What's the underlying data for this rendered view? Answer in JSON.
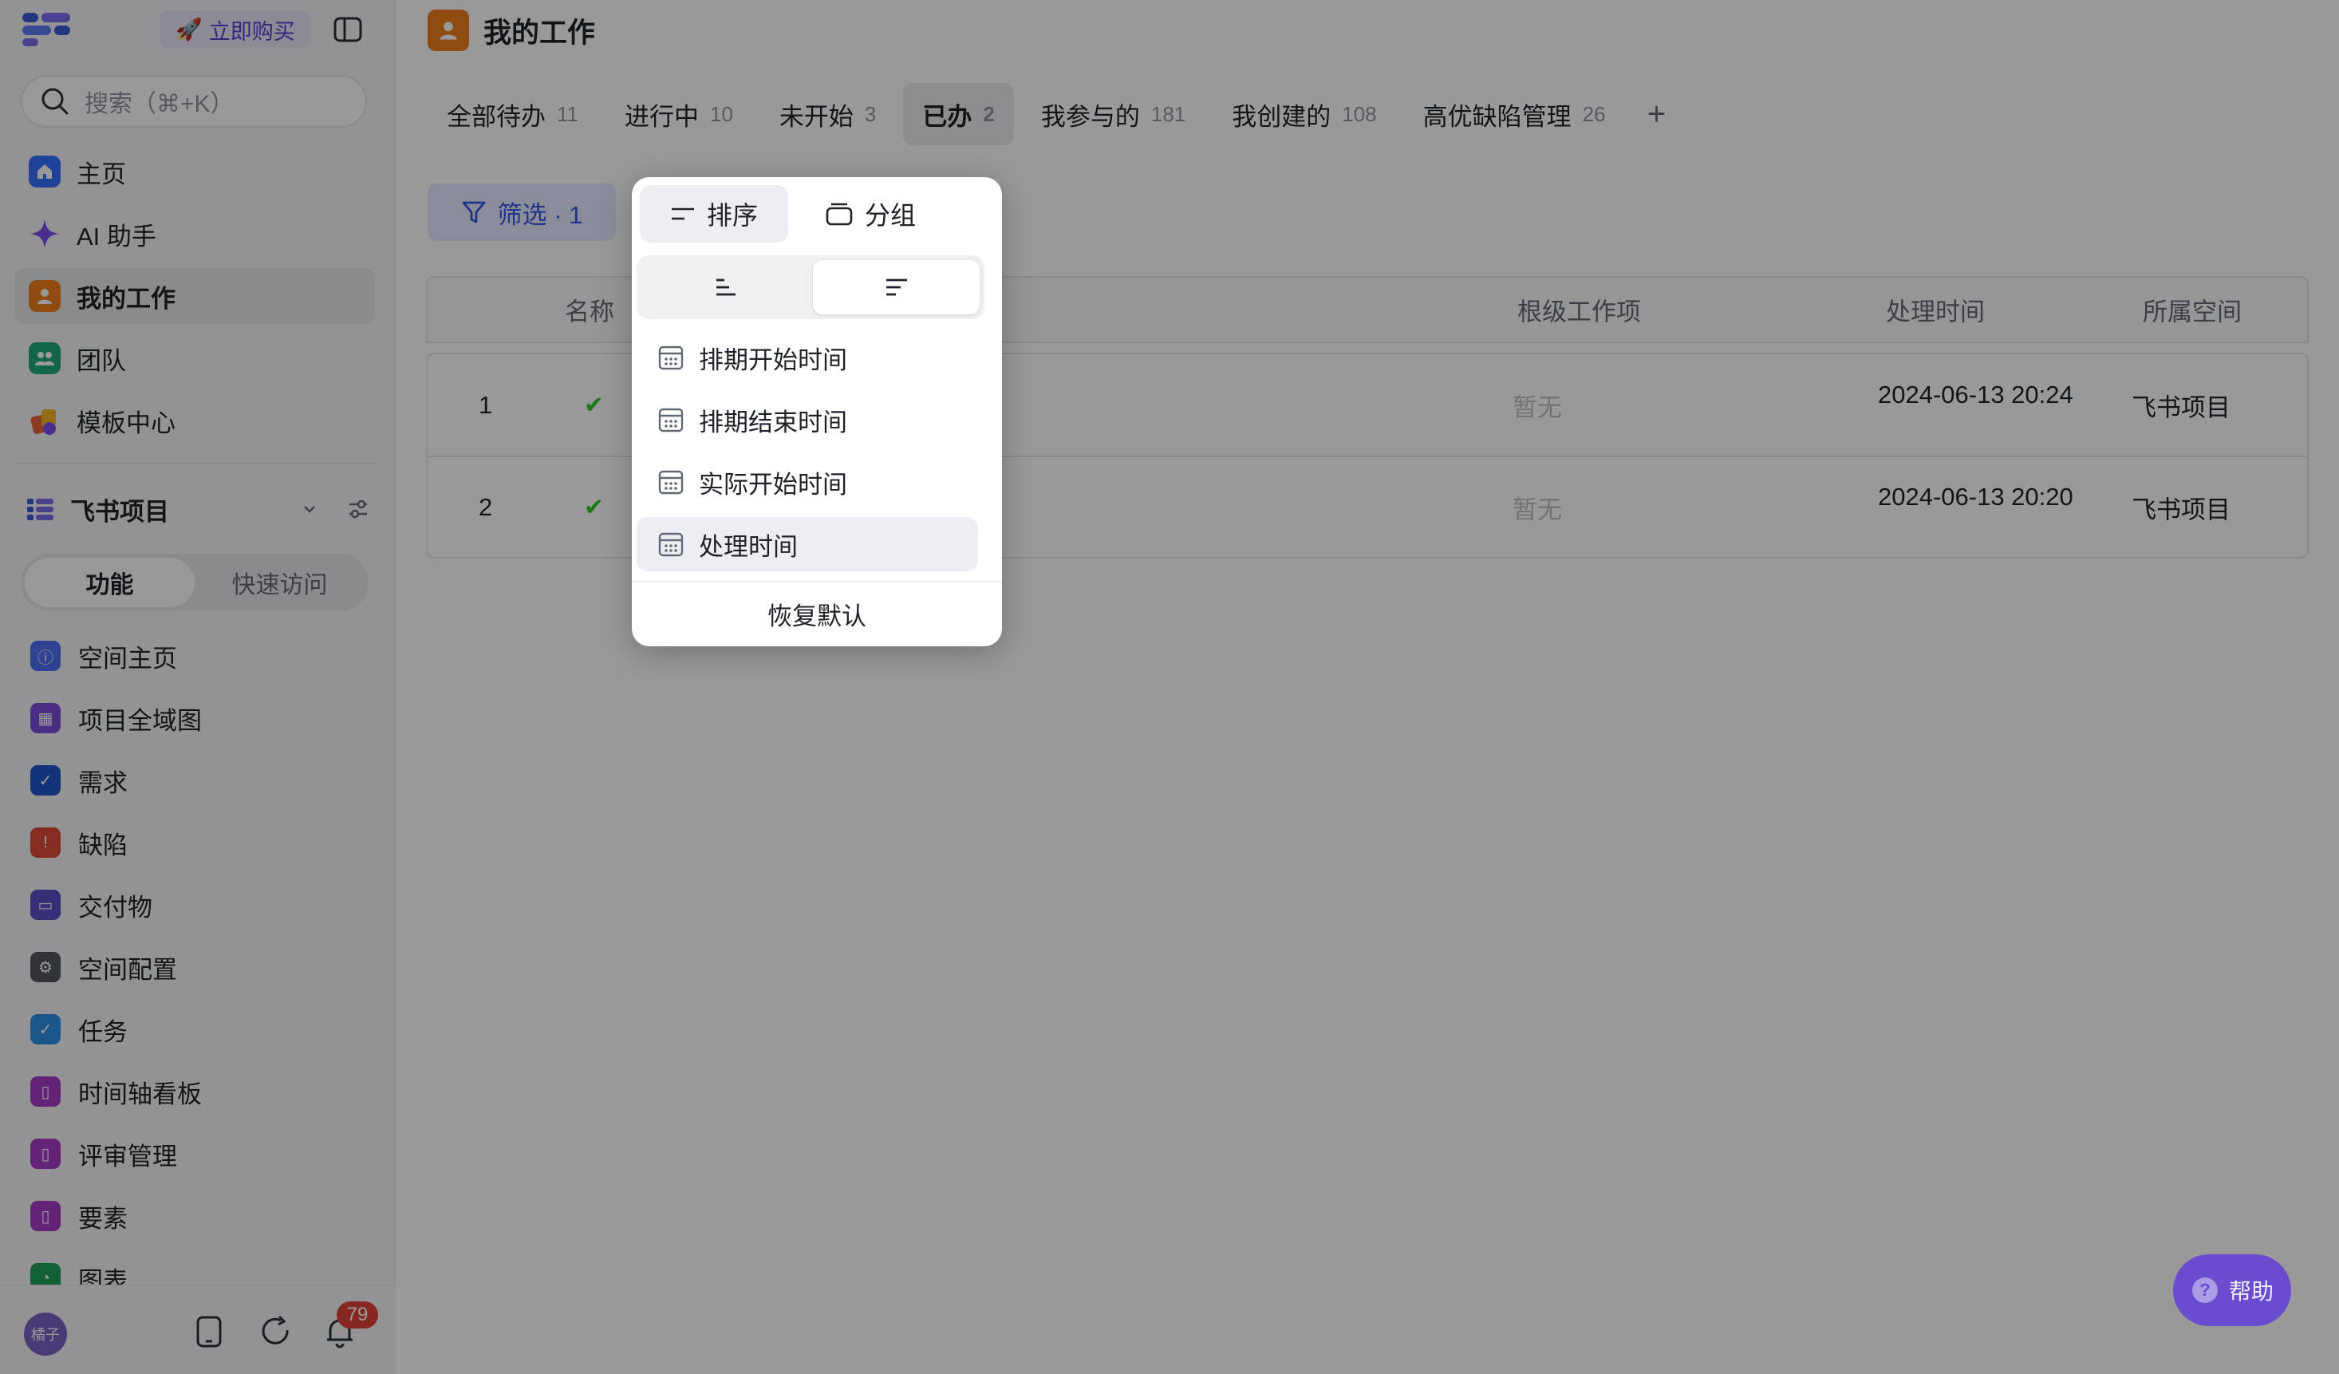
{
  "sidebar": {
    "buy_label": "立即购买",
    "search_placeholder": "搜索（⌘+K）",
    "nav": [
      {
        "label": "主页",
        "icon": "home-icon",
        "color": "#3370ff"
      },
      {
        "label": "AI 助手",
        "icon": "sparkle-icon",
        "color": "#7b4fe8"
      },
      {
        "label": "我的工作",
        "icon": "person-icon",
        "color": "#f07e1b"
      },
      {
        "label": "团队",
        "icon": "team-icon",
        "color": "#20a97a"
      },
      {
        "label": "模板中心",
        "icon": "template-icon",
        "color": "#e8643a"
      }
    ],
    "space": {
      "name": "飞书项目",
      "tabs": [
        "功能",
        "快速访问"
      ]
    },
    "space_items": [
      {
        "label": "空间主页",
        "icon": "info-icon",
        "color": "#4e6ef2"
      },
      {
        "label": "项目全域图",
        "icon": "grid-icon",
        "color": "#7a4ed9"
      },
      {
        "label": "需求",
        "icon": "check-circle-icon",
        "color": "#1f56c9"
      },
      {
        "label": "缺陷",
        "icon": "alert-icon",
        "color": "#e0483a"
      },
      {
        "label": "交付物",
        "icon": "folder-icon",
        "color": "#5a4fc7"
      },
      {
        "label": "空间配置",
        "icon": "gear-icon",
        "color": "#50555e"
      },
      {
        "label": "任务",
        "icon": "task-icon",
        "color": "#2d8fe8"
      },
      {
        "label": "时间轴看板",
        "icon": "bookmark-icon",
        "color": "#a63cc9"
      },
      {
        "label": "评审管理",
        "icon": "bookmark-icon",
        "color": "#a63cc9"
      },
      {
        "label": "要素",
        "icon": "bookmark-icon",
        "color": "#a63cc9"
      },
      {
        "label": "图表",
        "icon": "chart-icon",
        "color": "#22a05a"
      }
    ],
    "avatar_text": "橘子",
    "notification_count": "79"
  },
  "main": {
    "title": "我的工作",
    "tabs": [
      {
        "label": "全部待办",
        "count": "11"
      },
      {
        "label": "进行中",
        "count": "10"
      },
      {
        "label": "未开始",
        "count": "3"
      },
      {
        "label": "已办",
        "count": "2"
      },
      {
        "label": "我参与的",
        "count": "181"
      },
      {
        "label": "我创建的",
        "count": "108"
      },
      {
        "label": "高优缺陷管理",
        "count": "26"
      }
    ],
    "add_tab": "+",
    "filter_label": "筛选 · 1",
    "table": {
      "headers": [
        "名称",
        "根级工作项",
        "处理时间",
        "所属空间"
      ],
      "rows": [
        {
          "index": "1",
          "root": "暂无",
          "time": "2024-06-13 20:24",
          "space": "飞书项目"
        },
        {
          "index": "2",
          "root": "暂无",
          "time": "2024-06-13 20:20",
          "space": "飞书项目"
        }
      ]
    }
  },
  "sort_popup": {
    "tab_sort": "排序",
    "tab_group": "分组",
    "options": [
      "排期开始时间",
      "排期结束时间",
      "实际开始时间",
      "处理时间"
    ],
    "selected_option": "处理时间",
    "reset_label": "恢复默认"
  },
  "help_label": "帮助"
}
